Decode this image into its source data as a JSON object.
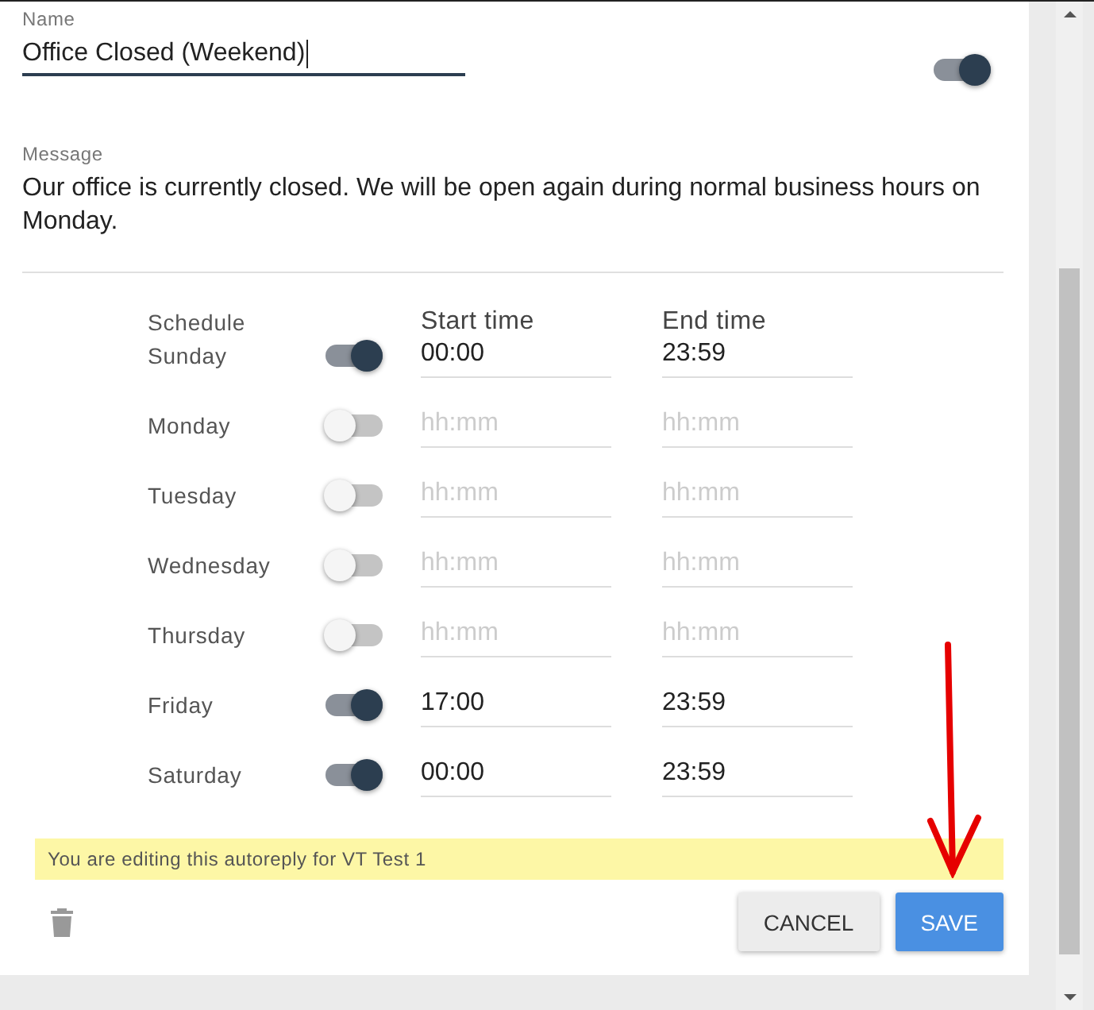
{
  "name_field": {
    "label": "Name",
    "value": "Office Closed (Weekend)",
    "focused": true
  },
  "enabled": true,
  "message": {
    "label": "Message",
    "value": "Our office is currently closed. We will be open again during normal business hours on Monday."
  },
  "schedule": {
    "headers": [
      "Schedule",
      "Start time",
      "End time"
    ],
    "days": [
      {
        "day": "Sunday",
        "on": true,
        "start": "00:00",
        "end": "23:59"
      },
      {
        "day": "Monday",
        "on": false,
        "start_placeholder": "hh:mm",
        "end_placeholder": "hh:mm"
      },
      {
        "day": "Tuesday",
        "on": false,
        "start_placeholder": "hh:mm",
        "end_placeholder": "hh:mm"
      },
      {
        "day": "Wednesday",
        "on": false,
        "start_placeholder": "hh:mm",
        "end_placeholder": "hh:mm"
      },
      {
        "day": "Thursday",
        "on": false,
        "start_placeholder": "hh:mm",
        "end_placeholder": "hh:mm"
      },
      {
        "day": "Friday",
        "on": true,
        "start": "17:00",
        "end": "23:59"
      },
      {
        "day": "Saturday",
        "on": true,
        "start": "00:00",
        "end": "23:59"
      }
    ]
  },
  "notice": "You are editing this autoreply for VT Test 1",
  "buttons": [
    {
      "label": "CANCEL",
      "kind": "secondary"
    },
    {
      "label": "SAVE",
      "kind": "primary"
    }
  ]
}
